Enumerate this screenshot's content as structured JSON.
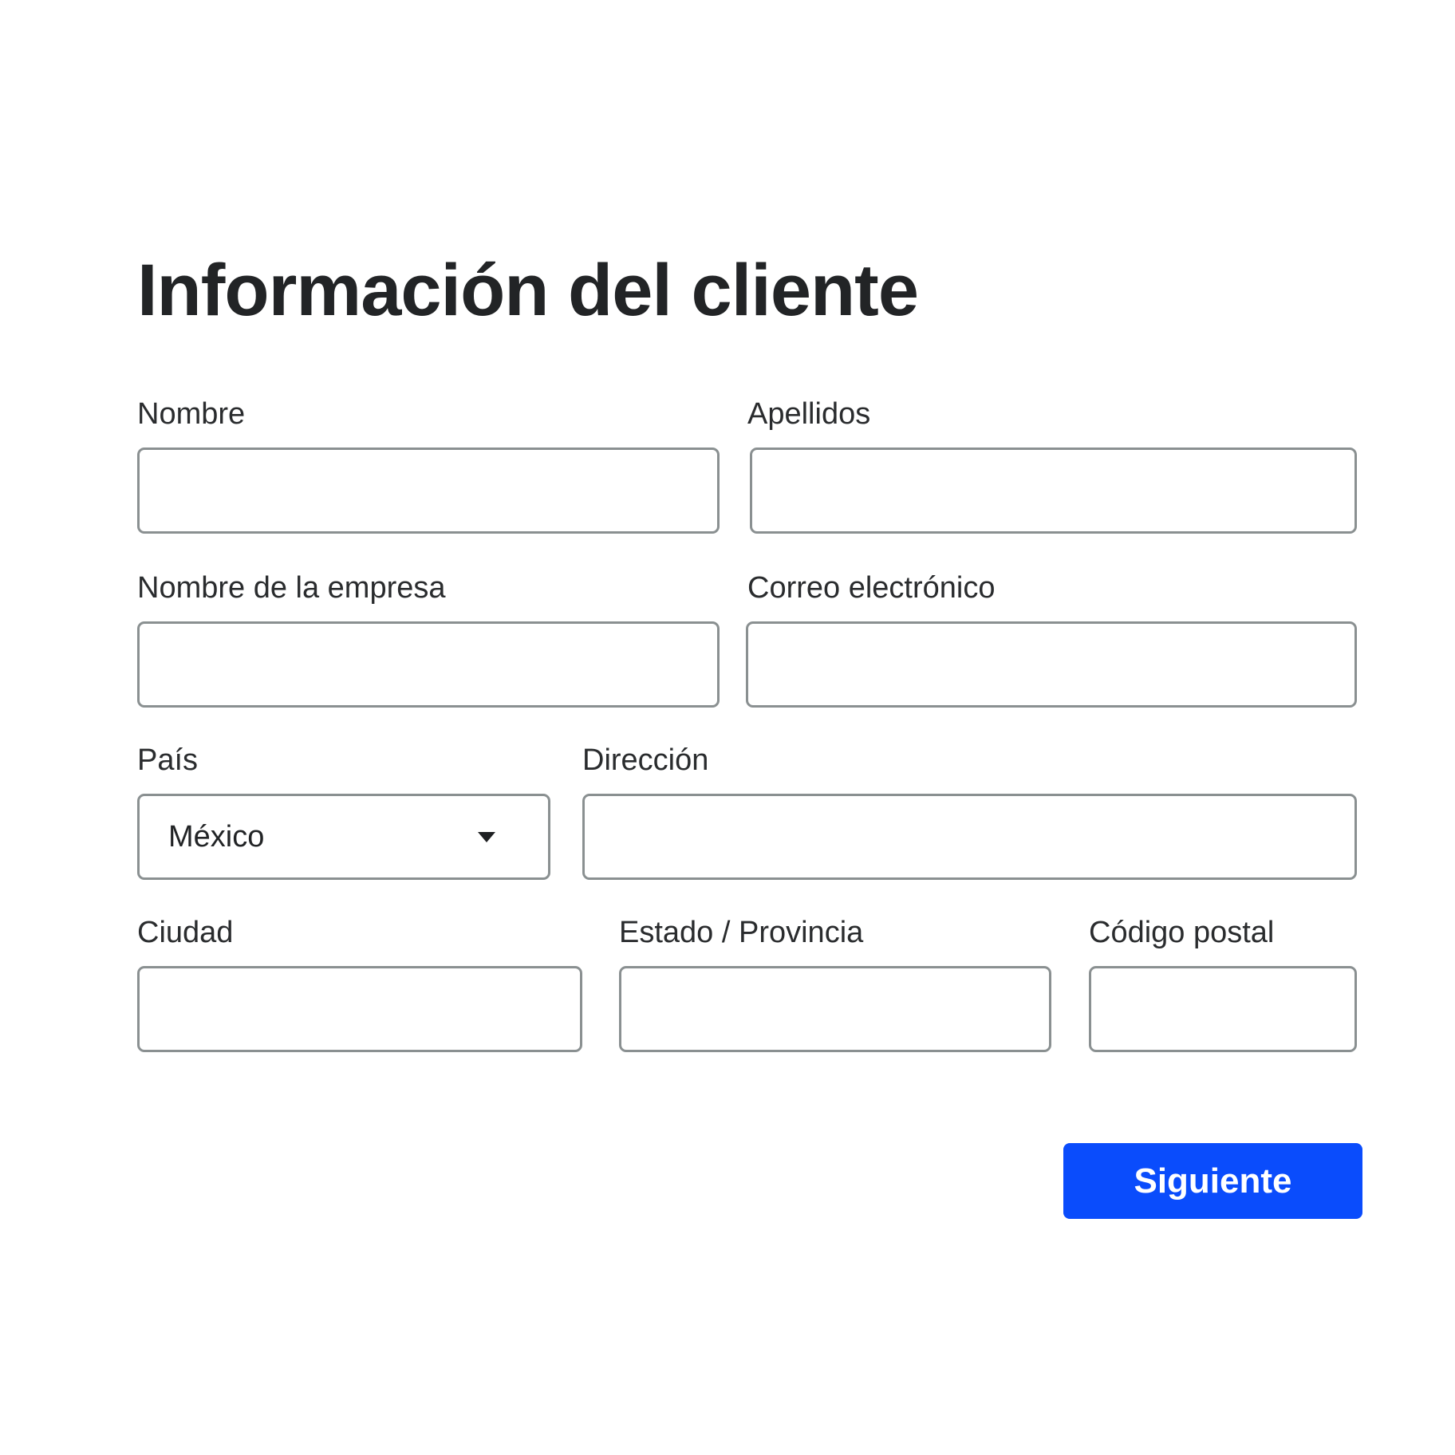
{
  "form": {
    "title": "Información del cliente",
    "fields": {
      "first_name": {
        "label": "Nombre",
        "value": ""
      },
      "last_name": {
        "label": "Apellidos",
        "value": ""
      },
      "company": {
        "label": "Nombre de la empresa",
        "value": ""
      },
      "email": {
        "label": "Correo electrónico",
        "value": ""
      },
      "country": {
        "label": "País",
        "selected": "México"
      },
      "address": {
        "label": "Dirección",
        "value": ""
      },
      "city": {
        "label": "Ciudad",
        "value": ""
      },
      "state": {
        "label": "Estado / Provincia",
        "value": ""
      },
      "postal_code": {
        "label": "Código postal",
        "value": ""
      }
    },
    "next_label": "Siguiente"
  },
  "colors": {
    "primary_button": "#0a4cfc",
    "field_border": "#8a9091",
    "text": "#222426"
  },
  "icons": {
    "country_dropdown": "caret-down-icon"
  }
}
